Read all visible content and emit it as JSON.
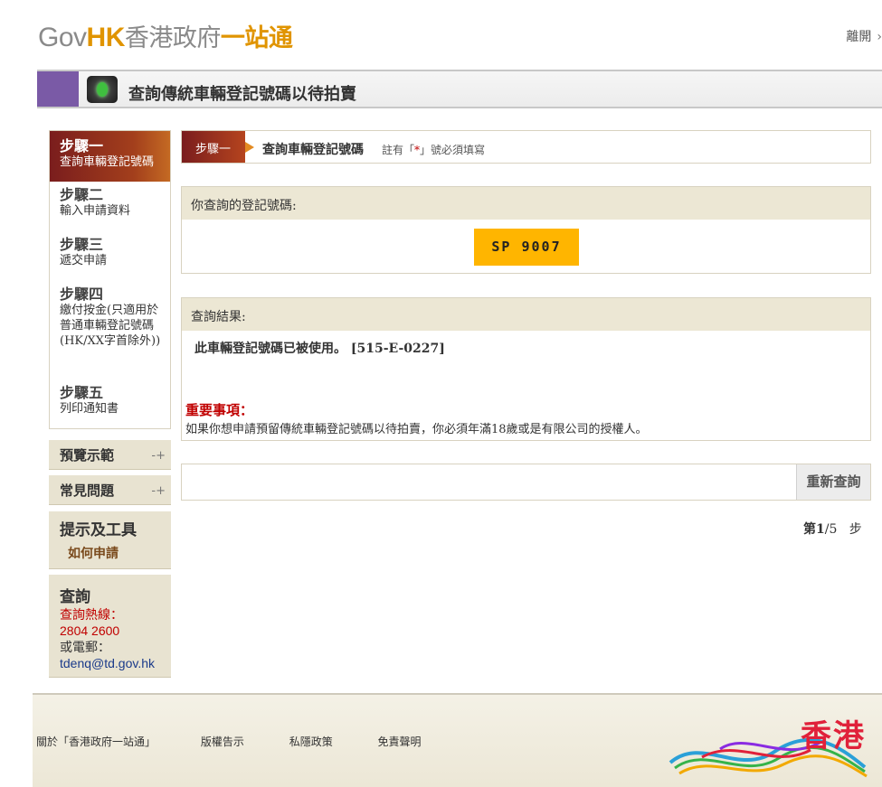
{
  "header": {
    "logo_gov": "Gov",
    "logo_hk": "HK",
    "logo_zh": "香港政府",
    "logo_zh2": "一站通",
    "exit_label": "離開"
  },
  "title": "查詢傳統車輛登記號碼以待拍賣",
  "steps": [
    {
      "heading": "步驟一",
      "desc": "查詢車輛登記號碼",
      "active": true
    },
    {
      "heading": "步驟二",
      "desc": "輸入申請資料"
    },
    {
      "heading": "步驟三",
      "desc": "遞交申請"
    },
    {
      "heading": "步驟四",
      "desc": "繳付按金(只適用於普通車輛登記號碼(HK/XX字首除外))"
    },
    {
      "heading": "步驟五",
      "desc": "列印通知書"
    }
  ],
  "sidebar": {
    "preview": "預覽示範",
    "faq": "常見問題",
    "tips_title": "提示及工具",
    "tips_link": "如何申請",
    "contact_title": "查詢",
    "hotline_label": "查詢熱線：",
    "hotline_number": "2804 2600",
    "email_label": "或電郵：",
    "email": "tdenq@td.gov.hk"
  },
  "stepbar": {
    "tag": "步驟一",
    "text": "查詢車輛登記號碼",
    "note_prefix": "註有「",
    "note_star": "*",
    "note_suffix": "」號必須填寫"
  },
  "query": {
    "heading": "你查詢的登記號碼:",
    "plate": "SP 9007"
  },
  "result": {
    "heading": "查詢結果:",
    "message": "此車輛登記號碼已被使用。 [515-E-0227]",
    "important_title": "重要事項：",
    "important_text": "如果你想申請預留傳統車輛登記號碼以待拍賣，你必須年滿18歲或是有限公司的授權人。"
  },
  "actions": {
    "retry": "重新查詢"
  },
  "pager": {
    "prefix": "第",
    "current": "1",
    "sep": "/",
    "total": "5",
    "suffix": "步"
  },
  "footer": {
    "links": [
      "關於「香港政府一站通」",
      "版權告示",
      "私隱政策",
      "免責聲明"
    ],
    "brand": "香港"
  }
}
